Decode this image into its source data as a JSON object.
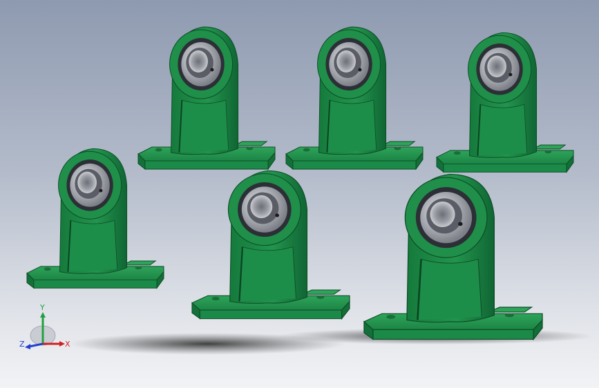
{
  "viewport": {
    "background_top": "#8e9ab0",
    "background_bottom": "#f2f3f5",
    "part_color": "#1f8f4a",
    "part_color_light": "#3fb36a",
    "part_color_dark": "#0f5a2c",
    "bearing_color": "#8d8f96"
  },
  "parts": [
    {
      "name": "pillow-block-bearing",
      "row": 1,
      "index": 1
    },
    {
      "name": "pillow-block-bearing",
      "row": 1,
      "index": 2
    },
    {
      "name": "pillow-block-bearing",
      "row": 1,
      "index": 3
    },
    {
      "name": "pillow-block-bearing",
      "row": 2,
      "index": 1
    },
    {
      "name": "pillow-block-bearing",
      "row": 2,
      "index": 2
    },
    {
      "name": "pillow-block-bearing",
      "row": 2,
      "index": 3
    }
  ],
  "triad": {
    "x_label": "X",
    "y_label": "Y",
    "z_label": "Z",
    "x_color": "#d02020",
    "y_color": "#20a040",
    "z_color": "#2040d0"
  }
}
